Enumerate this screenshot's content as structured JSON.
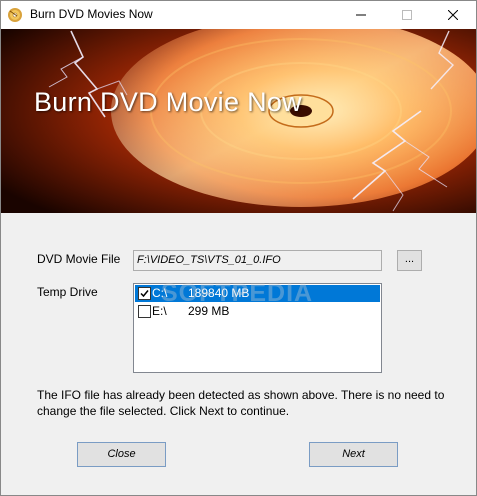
{
  "window": {
    "title": "Burn DVD Movies Now"
  },
  "titlebar_buttons": {
    "minimize_icon": "minimize-icon",
    "maximize_icon": "maximize-icon",
    "close_icon": "close-icon"
  },
  "banner": {
    "title": "Burn DVD Movie Now"
  },
  "form": {
    "dvd_movie_file_label": "DVD Movie File",
    "dvd_movie_file_value": "F:\\VIDEO_TS\\VTS_01_0.IFO",
    "browse_label": "...",
    "temp_drive_label": "Temp Drive",
    "drives": [
      {
        "letter": "C:\\",
        "size": "189840 MB",
        "checked": true,
        "selected": true
      },
      {
        "letter": "E:\\",
        "size": "299 MB",
        "checked": false,
        "selected": false
      }
    ]
  },
  "watermark": "SOFTPEDIA",
  "info_text": "The IFO file has already been detected as shown above. There is no need to change the file selected. Click Next to continue.",
  "buttons": {
    "close": "Close",
    "next": "Next"
  },
  "colors": {
    "selection": "#0078d7",
    "dialog_bg": "#f0f0f0",
    "banner_orange": "#ff8a1c"
  }
}
